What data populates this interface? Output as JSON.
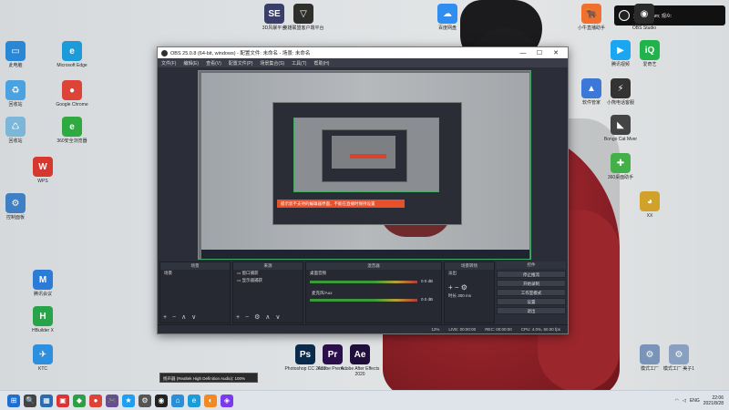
{
  "desktop": {
    "left_icons": [
      {
        "label": "此电脑",
        "color": "#2a87d6",
        "glyph": "▭"
      },
      {
        "label": "Microsoft Edge",
        "color": "#1c9bd8",
        "glyph": "e"
      },
      {
        "label": "回收站",
        "color": "#4aa3e0",
        "glyph": "♻"
      },
      {
        "label": "Google Chrome",
        "color": "#db4437",
        "glyph": "●"
      },
      {
        "label": "回收站",
        "color": "#7cb7d9",
        "glyph": "♺"
      },
      {
        "label": "360安全浏览器",
        "color": "#2eaa40",
        "glyph": "e"
      },
      {
        "label": "WPS",
        "color": "#d4382f",
        "glyph": "W"
      },
      {
        "label": "控制面板",
        "color": "#3f7fc3",
        "glyph": "⚙"
      },
      {
        "label": "腾讯会议",
        "color": "#2c7bd6",
        "glyph": "M"
      },
      {
        "label": "HBuilder X",
        "color": "#29a34a",
        "glyph": "H"
      },
      {
        "label": "KTC",
        "color": "#2f8fdf",
        "glyph": "✈"
      }
    ],
    "top_icons": [
      {
        "label": "3D风暴平台",
        "color": "#3a3f6a",
        "glyph": "SE"
      },
      {
        "label": "英雄联盟客户端平台",
        "color": "#2e2f2a",
        "glyph": "▽"
      },
      {
        "label": "百度网盘",
        "color": "#2f8ef0",
        "glyph": "☁"
      }
    ],
    "right_icons": [
      {
        "label": "小牛直播助手",
        "color": "#f0702e",
        "glyph": "🐂"
      },
      {
        "label": "OBS Studio",
        "color": "#2a2a2a",
        "glyph": "◉"
      },
      {
        "label": "腾讯视频",
        "color": "#1aa6f0",
        "glyph": "▶"
      },
      {
        "label": "爱奇艺",
        "color": "#22b24c",
        "glyph": "iQ"
      },
      {
        "label": "软件管家",
        "color": "#3b78d8",
        "glyph": "▲"
      },
      {
        "label": "小熊电话客服",
        "color": "#333",
        "glyph": "⚡"
      },
      {
        "label": "Bongo Cat Mver",
        "color": "#444",
        "glyph": "◣"
      },
      {
        "label": "360桌面助手",
        "color": "#44b04a",
        "glyph": "✚"
      },
      {
        "label": "XX",
        "color": "#d0a22a",
        "glyph": "◕"
      }
    ],
    "bottom_icons": [
      {
        "label": "Photoshop CC 2019",
        "color": "#0b2b4c",
        "glyph": "Ps"
      },
      {
        "label": "Adobe Premi...",
        "color": "#2a0f4a",
        "glyph": "Pr"
      },
      {
        "label": "Adobe After Effects 2020",
        "color": "#1f0d3a",
        "glyph": "Ae"
      }
    ],
    "bottom_right_icons": [
      {
        "label": "模式工厂",
        "color": "#7a93b8",
        "glyph": "⚙"
      },
      {
        "label": "模式工厂 美子1",
        "color": "#8aa0c0",
        "glyph": "⚙"
      }
    ]
  },
  "notice": {
    "text": "直播中: Sam; 观众: "
  },
  "obs": {
    "title": "OBS 25.0.8 (64-bit, windows) - 配置文件: 未命名 - 场景: 未命名",
    "menu": [
      "文件(F)",
      "编辑(E)",
      "查看(V)",
      "配置文件(P)",
      "场景集合(S)",
      "工具(T)",
      "帮助(H)"
    ],
    "window_buttons": [
      "—",
      "☐",
      "✕"
    ],
    "banner_text": "提示您不支持的编辑器界面，不能在直播时保持设置",
    "docks": {
      "scenes": {
        "header": "场景",
        "items": [
          "场景"
        ]
      },
      "sources": {
        "header": "来源",
        "items": [
          "窗口捕获",
          "显示器捕获"
        ]
      },
      "mixer": {
        "header": "混音器",
        "tracks": [
          {
            "name": "桌面音频",
            "level": "0.0 dB"
          },
          {
            "name": "麦克风/Aux",
            "level": "0.0 dB"
          }
        ]
      },
      "transitions": {
        "header": "场景转场",
        "type": "淡出",
        "duration_label": "时长",
        "duration": "300 ms"
      },
      "controls": {
        "header": "控件",
        "buttons": [
          "停止推流",
          "开始录制",
          "工作室模式",
          "设置",
          "退出"
        ]
      }
    },
    "status": {
      "live": "LIVE: 00:00:00",
      "rec": "REC: 00:00:00",
      "cpu": "CPU: 4.0%, 60.00 fps",
      "fps_drop": "12%"
    }
  },
  "tooltip": {
    "text": "扬声器 (Realtek High Definition Audio): 100%"
  },
  "taskbar": {
    "apps": [
      "⊞",
      "🔍",
      "▦",
      "▣",
      "◆",
      "●",
      "🎮",
      "★",
      "⚙",
      "◉",
      "⌂",
      "e",
      "◐",
      "◈"
    ],
    "tray": {
      "lang": "ENG",
      "time": "22:06",
      "date": "2021/8/28"
    }
  }
}
